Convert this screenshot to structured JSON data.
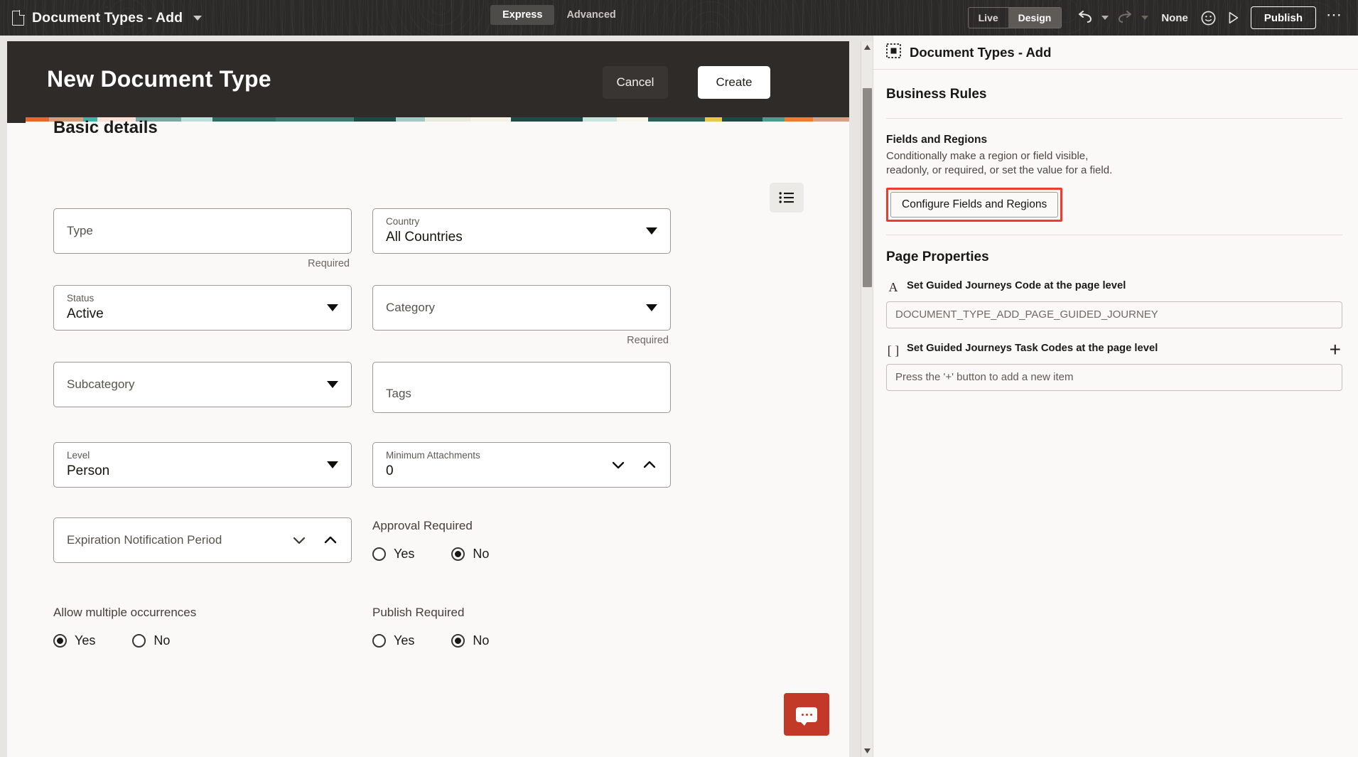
{
  "topbar": {
    "doc_icon": "document-icon",
    "title": "Document Types - Add",
    "mode_tabs": [
      {
        "label": "Express",
        "selected": true
      },
      {
        "label": "Advanced",
        "selected": false
      }
    ],
    "live_design": [
      {
        "label": "Live",
        "selected": false
      },
      {
        "label": "Design",
        "selected": true
      }
    ],
    "undo_icon": "undo-icon",
    "redo_icon": "redo-icon",
    "none_label": "None",
    "smiley_icon": "smiley-icon",
    "preview_icon": "play-preview-icon",
    "publish_label": "Publish",
    "overflow_label": "⋯"
  },
  "canvas": {
    "page_title": "New Document Type",
    "cancel_label": "Cancel",
    "create_label": "Create",
    "section_title": "Basic details",
    "list_icon": "list-view-icon",
    "strip_colors": [
      "#e8682c",
      "#d89b79",
      "#3cb5a8",
      "#fbe0d6",
      "#7aa8a2",
      "#b9e0da",
      "#2f6b63",
      "#3f7a72",
      "#1d4a45",
      "#9fc9c2",
      "#e8eadb",
      "#f4f2e4",
      "#1e4b47",
      "#c9e3de",
      "#f7f5e9",
      "#2d5f59",
      "#e8c84a",
      "#1d4a45",
      "#4f9b8f",
      "#f07b2e",
      "#d8a085"
    ],
    "fields": {
      "type": {
        "placeholder": "Type",
        "value": "",
        "helper": "Required"
      },
      "country": {
        "label": "Country",
        "value": "All Countries",
        "control": "dropdown"
      },
      "status": {
        "label": "Status",
        "value": "Active",
        "control": "dropdown"
      },
      "category": {
        "placeholder": "Category",
        "value": "",
        "control": "dropdown",
        "helper": "Required"
      },
      "subcategory": {
        "placeholder": "Subcategory",
        "value": "",
        "control": "dropdown"
      },
      "tags": {
        "placeholder": "Tags",
        "value": ""
      },
      "level": {
        "label": "Level",
        "value": "Person",
        "control": "dropdown"
      },
      "minimum_attachments": {
        "label": "Minimum Attachments",
        "value": "0",
        "control": "stepper"
      },
      "expiration_notification_period": {
        "placeholder": "Expiration Notification Period",
        "value": "",
        "control": "stepper"
      }
    },
    "radio_groups": [
      {
        "label": "Approval Required",
        "options": [
          {
            "label": "Yes",
            "selected": false
          },
          {
            "label": "No",
            "selected": true
          }
        ]
      },
      {
        "label": "Allow multiple occurrences",
        "options": [
          {
            "label": "Yes",
            "selected": true
          },
          {
            "label": "No",
            "selected": false
          }
        ]
      },
      {
        "label": "Publish Required",
        "options": [
          {
            "label": "Yes",
            "selected": false
          },
          {
            "label": "No",
            "selected": true
          }
        ]
      }
    ],
    "chat_icon": "chat-bubble-icon",
    "scroll_up_icon": "scroll-up-arrow",
    "scroll_down_icon": "scroll-down-arrow"
  },
  "right_panel": {
    "header_icon": "page-region-icon",
    "header_title": "Document Types - Add",
    "business_rules_heading": "Business Rules",
    "fields_regions_title": "Fields and Regions",
    "fields_regions_desc": "Conditionally make a region or field visible, readonly, or required, or set the value for a field.",
    "configure_button": "Configure Fields and Regions",
    "highlight_color": "#f03a2e",
    "page_properties_heading": "Page Properties",
    "guided_code": {
      "icon": "text-field-icon",
      "icon_glyph": "A",
      "label": "Set Guided Journeys Code at the page level",
      "placeholder": "DOCUMENT_TYPE_ADD_PAGE_GUIDED_JOURNEY",
      "value": ""
    },
    "guided_tasks": {
      "icon": "array-field-icon",
      "icon_glyph": "[ ]",
      "label": "Set Guided Journeys Task Codes at the page level",
      "add_icon": "plus-icon",
      "empty_text": "Press the '+' button to add a new item"
    }
  }
}
